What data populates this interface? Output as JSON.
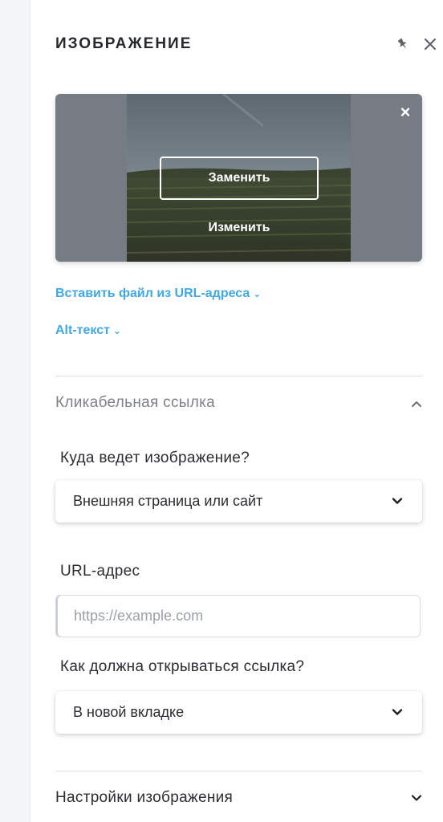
{
  "panel": {
    "title": "ИЗОБРАЖЕНИЕ",
    "pin_icon": "pin-icon",
    "close_icon": "close-icon"
  },
  "image_card": {
    "replace_label": "Заменить",
    "edit_label": "Изменить",
    "remove_icon": "close-icon"
  },
  "links": {
    "insert_url": "Вставить файл из URL-адреса",
    "alt_text": "Alt-текст"
  },
  "clickable_link": {
    "title": "Кликабельная ссылка",
    "where_label": "Куда ведет изображение?",
    "where_value": "Внешняя страница или сайт",
    "url_label": "URL-адрес",
    "url_placeholder": "https://example.com",
    "url_value": "",
    "open_label": "Как должна открываться ссылка?",
    "open_value": "В новой вкладке"
  },
  "image_settings": {
    "title": "Настройки изображения"
  },
  "colors": {
    "accent": "#3fa9e6",
    "text": "#2b2d33",
    "muted": "#7c818a"
  }
}
